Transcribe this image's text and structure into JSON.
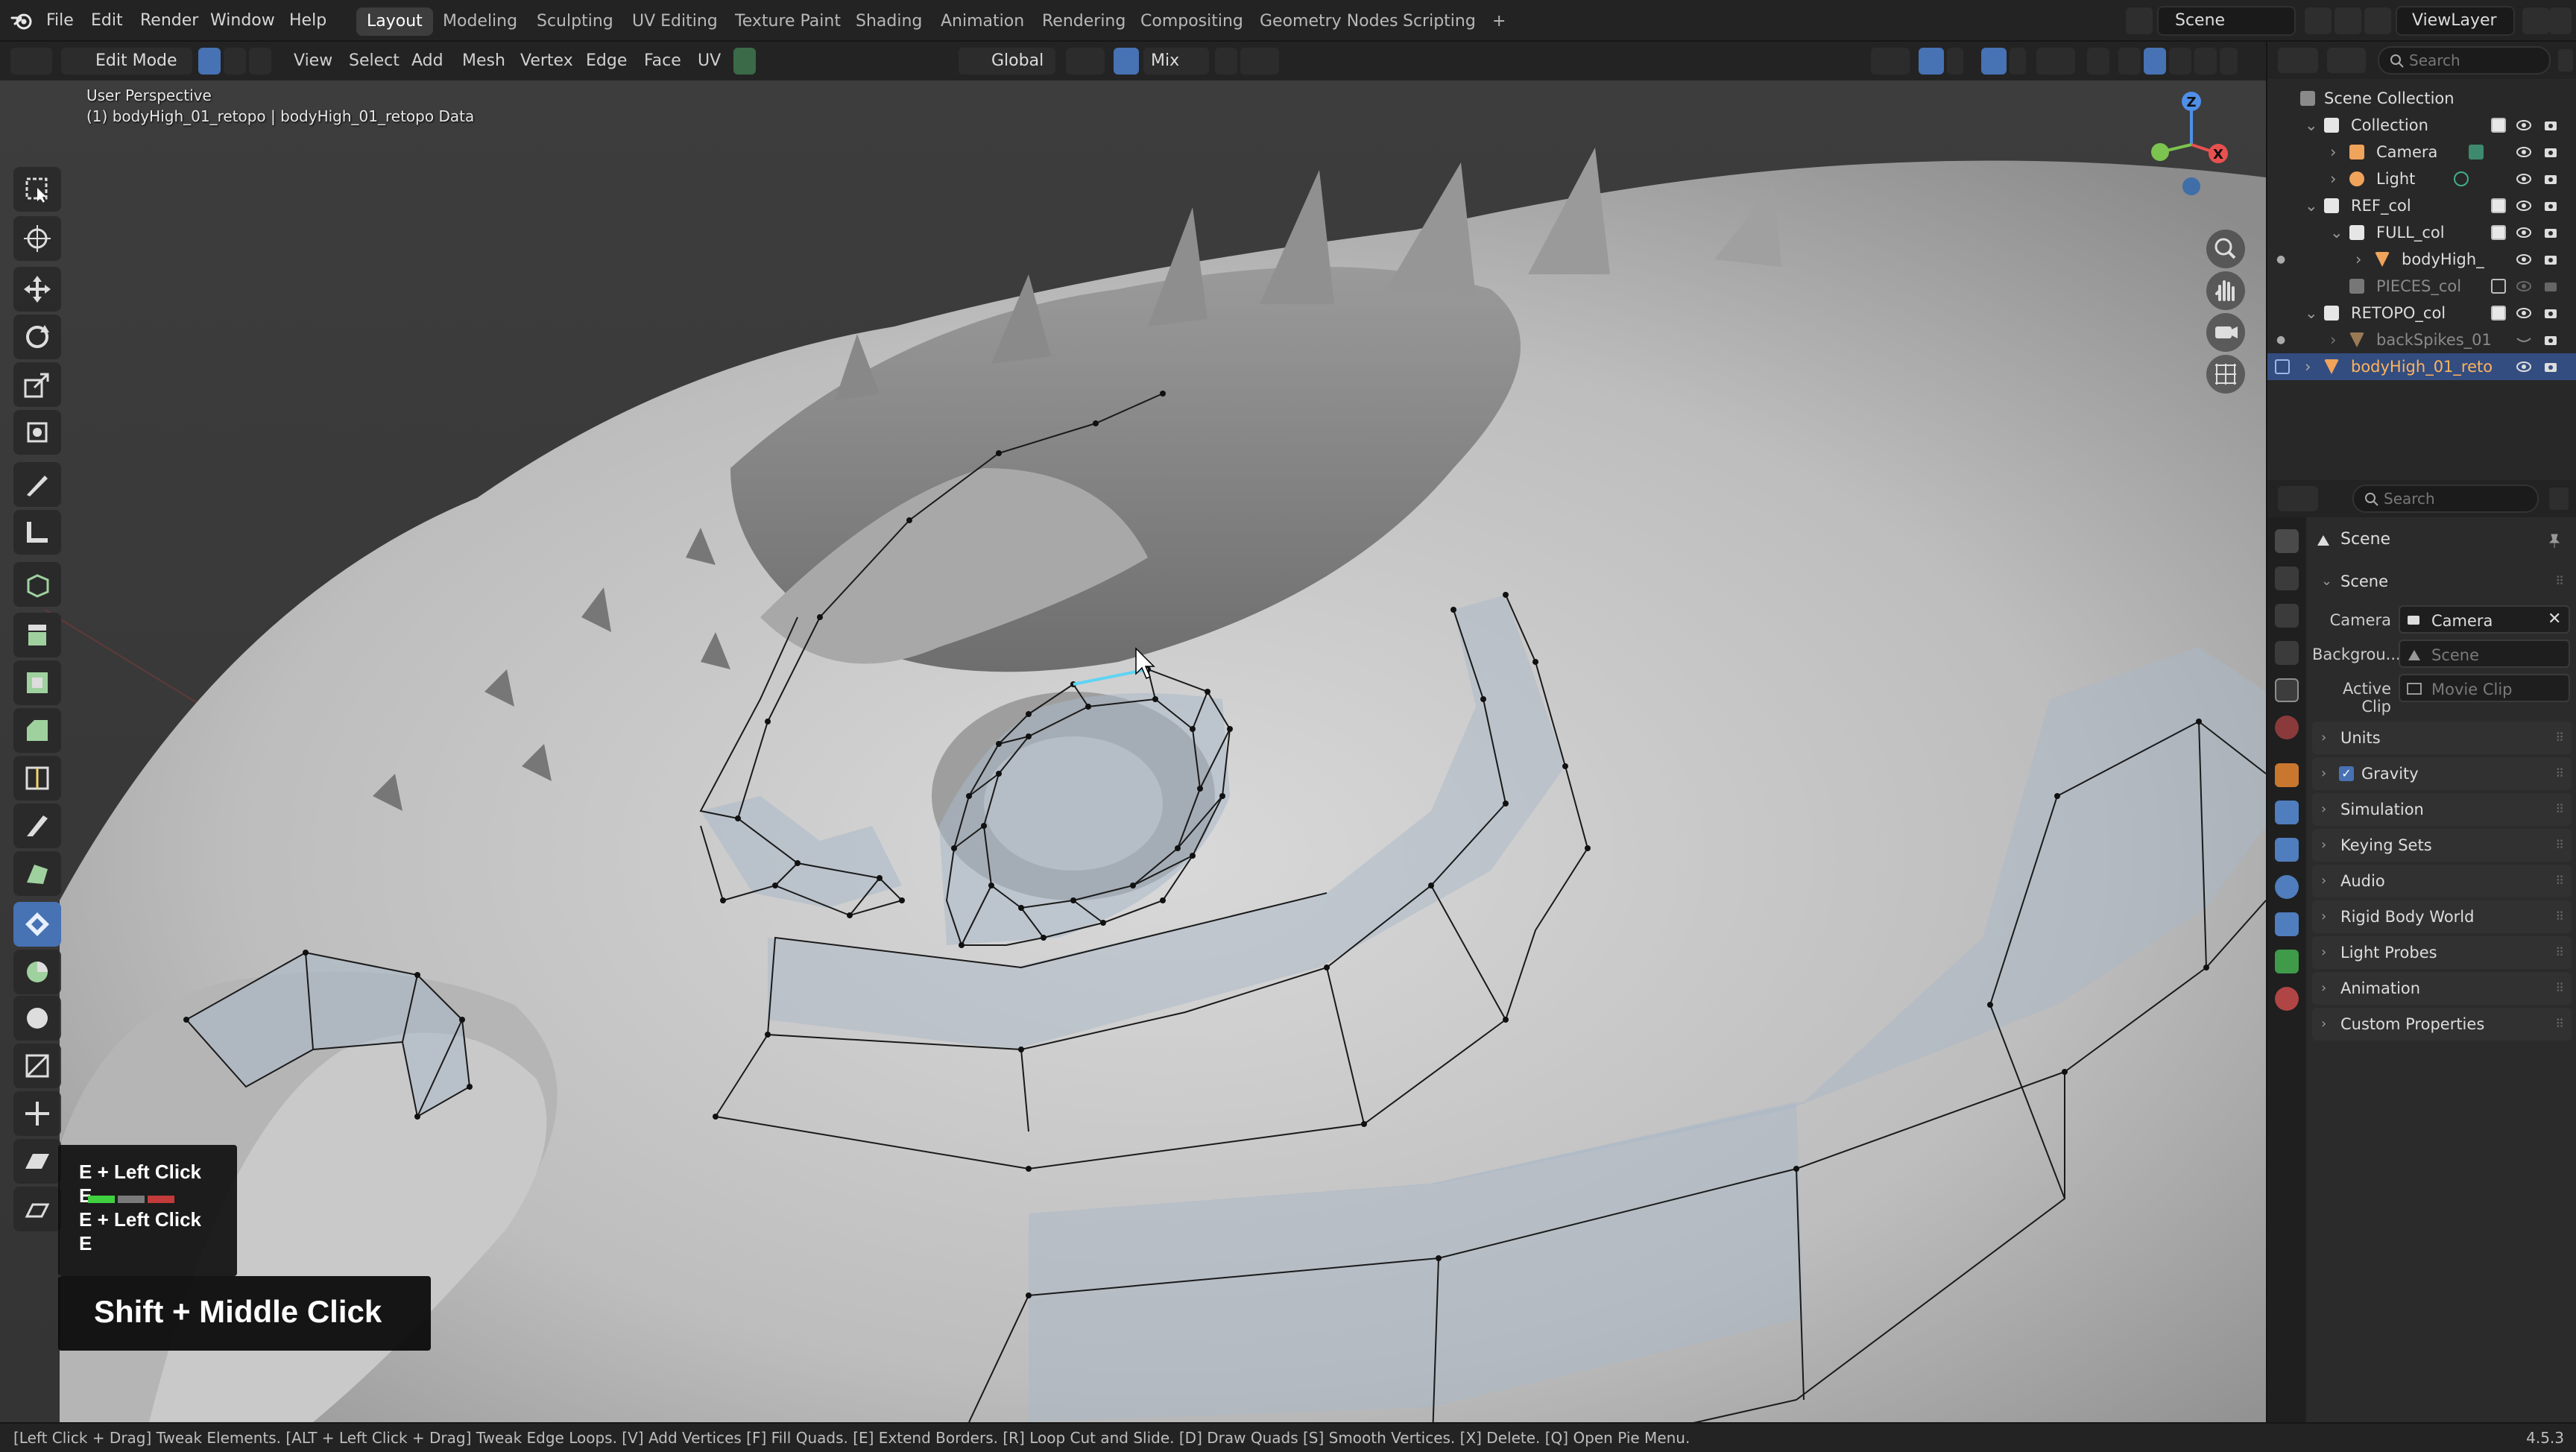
{
  "menus": [
    "File",
    "Edit",
    "Render",
    "Window",
    "Help"
  ],
  "workspaces": [
    "Layout",
    "Modeling",
    "Sculpting",
    "UV Editing",
    "Texture Paint",
    "Shading",
    "Animation",
    "Rendering",
    "Compositing",
    "Geometry Nodes",
    "Scripting"
  ],
  "add_workspace": "+",
  "scene_name": "Scene",
  "view_layer": "ViewLayer",
  "viewport_header": {
    "mode": "Edit Mode",
    "menus": [
      "View",
      "Select",
      "Add",
      "Mesh",
      "Vertex",
      "Edge",
      "Face",
      "UV"
    ],
    "orientation": "Global",
    "snap_target": "Mix"
  },
  "overlay": {
    "view_name": "User Perspective",
    "object_info": "(1) bodyHigh_01_retopo | bodyHigh_01_retopo Data"
  },
  "gizmo": {
    "z": "Z",
    "x": "X"
  },
  "key_overlay": {
    "lines": [
      "E + Left Click",
      "E",
      "E + Left Click",
      "E"
    ],
    "big": "Shift + Middle Click"
  },
  "outliner": {
    "search_placeholder": "Search",
    "root": "Scene Collection",
    "rows": [
      {
        "label": "Collection",
        "type": "collection"
      },
      {
        "label": "Camera",
        "type": "camera"
      },
      {
        "label": "Light",
        "type": "light"
      },
      {
        "label": "REF_col",
        "type": "collection"
      },
      {
        "label": "FULL_col",
        "type": "collection"
      },
      {
        "label": "bodyHigh_",
        "type": "mesh"
      },
      {
        "label": "PIECES_col",
        "type": "collection"
      },
      {
        "label": "RETOPO_col",
        "type": "collection"
      },
      {
        "label": "backSpikes_01",
        "type": "mesh"
      },
      {
        "label": "bodyHigh_01_reto",
        "type": "mesh"
      }
    ]
  },
  "properties": {
    "search_placeholder": "Search",
    "context": "Scene",
    "panel_scene": "Scene",
    "fields": {
      "camera_label": "Camera",
      "camera_value": "Camera",
      "background_label": "Backgrou...",
      "background_value": "Scene",
      "clip_label": "Active Clip",
      "clip_value": "Movie Clip"
    },
    "panels": [
      "Units",
      "Gravity",
      "Simulation",
      "Keying Sets",
      "Audio",
      "Rigid Body World",
      "Light Probes",
      "Animation",
      "Custom Properties"
    ]
  },
  "status": {
    "hint": "[Left Click + Drag] Tweak Elements.   [ALT + Left Click + Drag] Tweak Edge Loops.   [V] Add Vertices   [F] Fill Quads.   [E] Extend Borders.   [R] Loop Cut and Slide.   [D] Draw Quads   [S] Smooth Vertices.   [X] Delete.   [Q] Open Pie Menu.",
    "version": "4.5.3"
  },
  "colors": {
    "accent": "#4772b3",
    "selection": "#334d80",
    "object_highlight": "#ffb35c"
  }
}
